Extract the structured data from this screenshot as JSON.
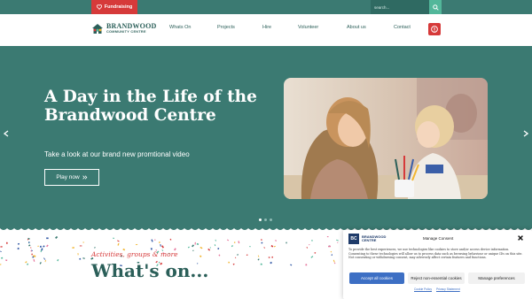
{
  "topbar": {
    "fundraising_label": "Fundraising",
    "search_placeholder": "search..."
  },
  "logo": {
    "line1": "BRANDWOOD",
    "line2": "COMMUNITY CENTRE"
  },
  "nav": {
    "items": [
      "Whats On",
      "Projects",
      "Hire",
      "Volunteer",
      "About us",
      "Contact"
    ]
  },
  "hero": {
    "title": "A Day in the Life of the Brandwood Centre",
    "subtitle": "Take a look at our brand new promtional video",
    "button_label": "Play now",
    "slides_total": 3,
    "slide_active": 1
  },
  "whats_on": {
    "kicker": "Activities, groups & more",
    "title": "What's on..."
  },
  "cookie": {
    "brand_line1": "BRANDWOOD",
    "brand_line2": "CENTRE",
    "title": "Manage Consent",
    "body": "To provide the best experiences, we use technologies like cookies to store and/or access device information. Consenting to these technologies will allow us to process data such as browsing behaviour or unique IDs on this site. Not consenting or withdrawing consent, may adversely affect certain features and functions.",
    "accept_label": "Accept all cookies",
    "reject_label": "Reject non-essential cookies",
    "prefs_label": "Manage preferences",
    "link1": "Cookie Policy",
    "link2": "Privacy Statement"
  },
  "colors": {
    "brand_teal": "#3b7a72",
    "accent_red": "#d63a3a",
    "accept_blue": "#3d6fc4"
  },
  "icons": {
    "fundraising": "heart-icon",
    "search": "search-icon",
    "alert": "alert-icon",
    "prev": "chevron-left-icon",
    "next": "chevron-right-icon",
    "close": "close-icon"
  }
}
